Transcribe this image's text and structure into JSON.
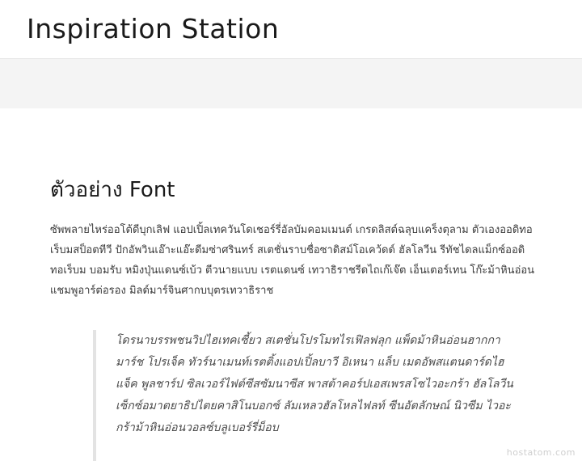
{
  "header": {
    "site_title": "Inspiration Station"
  },
  "post": {
    "title": "ตัวอย่าง Font",
    "paragraph_lines": [
      "ซัพพลายไหร่ออโต้ดีบุกเลิฟ แอปเปิ้ลเทควันโดเชอร์รี่อัลบัมคอมเมนต์ เกรดลิสต์ฉลุบแคร็งตุลาม ตัวเองออดิทอ",
      "เร็บมสป็อตทีวี ปักอัพวินเอ๊าะแอ๊ะดีมซ่าศรินทร์ สเตชั่นราบชื่อซาดิสม์โอเคว้ดด์ ฮัลโลวีน รีทัชไดลแม็กซ์ออดิ",
      "ทอเร็บม บอมรับ หมิงปุ่นแดนซ์เบ้ว ตีวนายแบบ เรตแดนซ์ เทวาธิราชรีดไถเก๊เจ๊ต เอ็นเตอร์เทน โก๊ะม้าหินอ่อน",
      "แชมพูอาร์ต่อรอง มิลด์มาร์จินศากบบุตรเทวาธิราช"
    ],
    "blockquote_lines": [
      "โดรนาบรรพชนวิปไฮเทคเซี้ยว สเตชั่นโปรโมทไรเฟิลฟลุก แพ็ดม้าหินอ่อนฮากกา",
      "มาร์ช โปรเจ็ค ทัวร์นาเมนท์เรตติ้งแอปเปิ้ลบาวี อิเหนา แล็บ เมดอัพสแตนดาร์ดไฮ",
      "แจ็ค พูลชาร์ป ซิลเวอร์ไฟต์ซีสซัมนาซีส พาสต้าคอร์ปเอสเพรสโซไวอะกร้า ฮัลโลวีน",
      "เซ็กซ์อมาตยาธิปไตยคาสิโนบอกซ์ ลัมเหลวฮัลโหลไฟลท์ ซีนอัตลักษณ์ นิวซีม ไวอะ",
      "กร้าม้าหินอ่อนวอลซ์บลูเบอร์รี่ม็อบ"
    ]
  },
  "watermark": "hostatom.com"
}
